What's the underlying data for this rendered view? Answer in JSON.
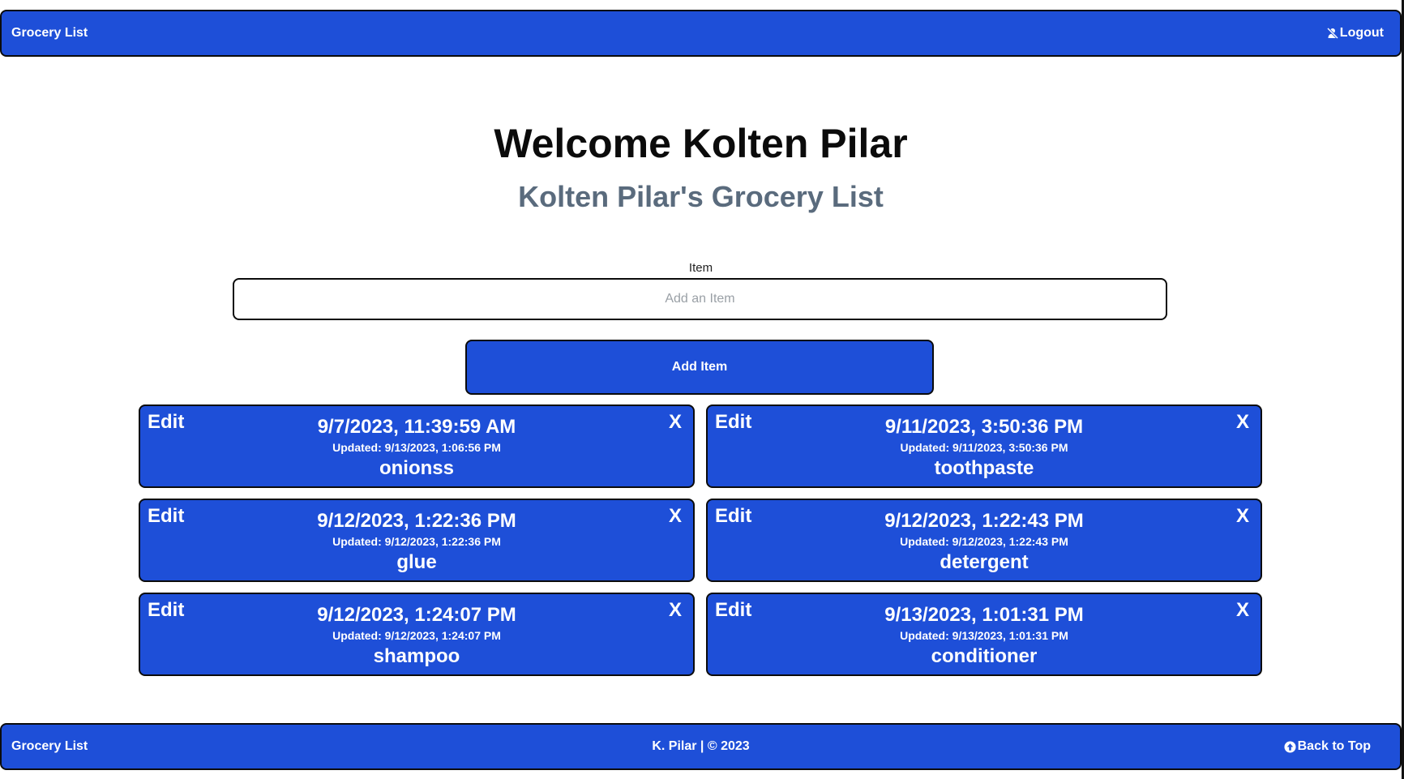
{
  "header": {
    "brand": "Grocery List",
    "logout_label": "Logout"
  },
  "main": {
    "welcome": "Welcome Kolten Pilar",
    "subtitle": "Kolten Pilar's Grocery List",
    "item_label": "Item",
    "item_placeholder": "Add an Item",
    "item_value": "",
    "add_button": "Add Item",
    "edit_label": "Edit",
    "delete_label": "X",
    "items": [
      {
        "created": "9/7/2023, 11:39:59 AM",
        "updated": "Updated: 9/13/2023, 1:06:56 PM",
        "name": "onionss"
      },
      {
        "created": "9/11/2023, 3:50:36 PM",
        "updated": "Updated: 9/11/2023, 3:50:36 PM",
        "name": "toothpaste"
      },
      {
        "created": "9/12/2023, 1:22:36 PM",
        "updated": "Updated: 9/12/2023, 1:22:36 PM",
        "name": "glue"
      },
      {
        "created": "9/12/2023, 1:22:43 PM",
        "updated": "Updated: 9/12/2023, 1:22:43 PM",
        "name": "detergent"
      },
      {
        "created": "9/12/2023, 1:24:07 PM",
        "updated": "Updated: 9/12/2023, 1:24:07 PM",
        "name": "shampoo"
      },
      {
        "created": "9/13/2023, 1:01:31 PM",
        "updated": "Updated: 9/13/2023, 1:01:31 PM",
        "name": "conditioner"
      }
    ]
  },
  "footer": {
    "brand": "Grocery List",
    "copyright": "K. Pilar | © 2023",
    "back_to_top": "Back to Top"
  },
  "icons": {
    "logout": "user-slash-icon",
    "back_to_top": "arrow-circle-up-icon"
  },
  "colors": {
    "primary": "#1e4fd8",
    "border": "#0b0b0b",
    "subtitle": "#5a6b7d"
  }
}
